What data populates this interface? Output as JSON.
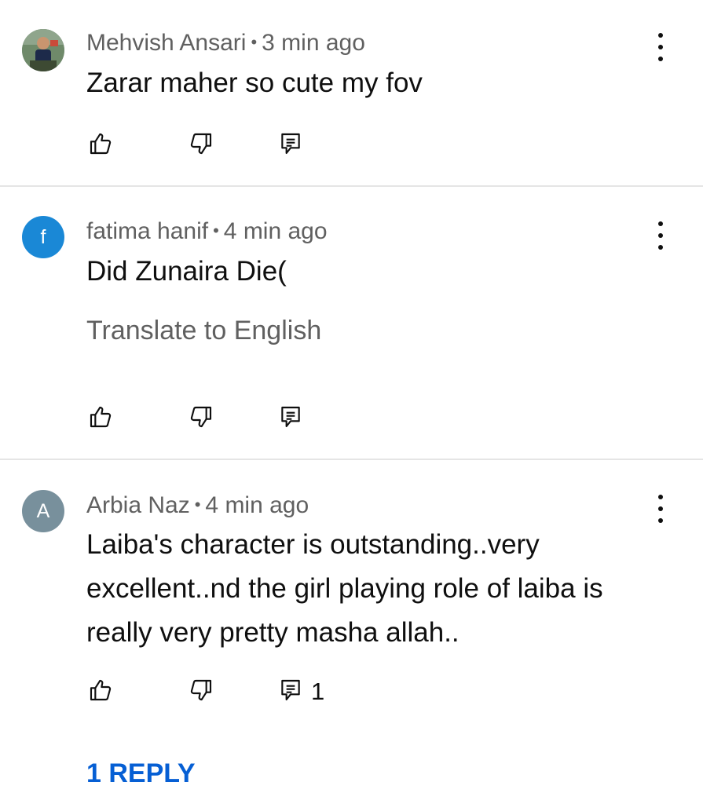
{
  "comments": [
    {
      "author": "Mehvish Ansari",
      "time": "3 min ago",
      "text": "Zarar maher so cute my fov",
      "avatar_type": "photo"
    },
    {
      "author": "fatima hanif",
      "time": "4 min ago",
      "text": "Did Zunaira Die(",
      "translate_label": "Translate to English",
      "avatar_letter": "f",
      "avatar_color": "#1a88d6"
    },
    {
      "author": "Arbia Naz",
      "time": "4 min ago",
      "text": "Laiba's character is outstanding..very excellent..nd the girl playing role of laiba is really very pretty masha allah..",
      "avatar_letter": "A",
      "avatar_color": "#78909c",
      "reply_count": "1",
      "replies_link": "1 REPLY"
    }
  ],
  "separator": "•",
  "icons": {
    "like": "thumbs-up-icon",
    "dislike": "thumbs-down-icon",
    "reply": "comment-icon",
    "menu": "more-vert-icon"
  },
  "colors": {
    "link": "#065fd4",
    "meta": "#606060",
    "divider": "#e5e5e5"
  }
}
